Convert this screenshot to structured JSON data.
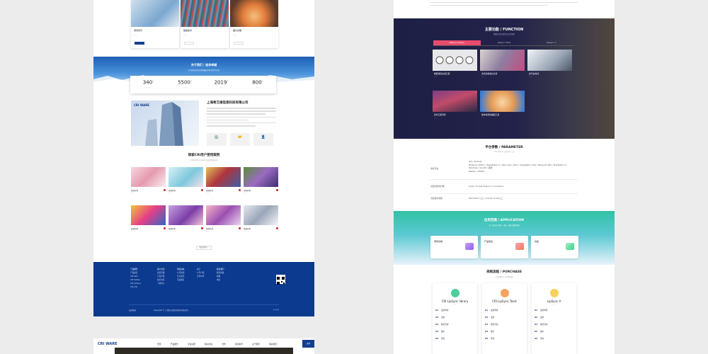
{
  "left": {
    "features": [
      {
        "title": "游戏音乐",
        "desc": "——",
        "button": "——"
      },
      {
        "title": "播放技术",
        "desc": "——",
        "button": "——"
      },
      {
        "title": "图片处理",
        "desc": "——",
        "button": "——"
      }
    ],
    "about": {
      "title": "关于我们 / 追求卓越",
      "subtitle": "以为游戏开发者提供最好的中间件为己任",
      "stats": [
        {
          "num": "340",
          "sup": "+",
          "label": "——"
        },
        {
          "num": "5500",
          "sup": "+",
          "label": "——"
        },
        {
          "num": "2019",
          "sup": "+",
          "label": "——"
        },
        {
          "num": "800",
          "sup": "+",
          "label": "——"
        }
      ]
    },
    "company": {
      "logo": "CRI WARE",
      "name": "上海希艾维信息科技有限公司",
      "icons": [
        "🏢",
        "🤝",
        "👤"
      ]
    },
    "cases": {
      "title": "探索CRI用户使用案例",
      "subtitle": "CRI中间件在全球众多游戏中被采用",
      "items": [
        {
          "title": "游戏名称",
          "sub": "——"
        },
        {
          "title": "游戏名称",
          "sub": "——"
        },
        {
          "title": "游戏名称",
          "sub": "——"
        },
        {
          "title": "游戏名称",
          "sub": "——"
        },
        {
          "title": "游戏名称",
          "sub": "——"
        },
        {
          "title": "游戏名称",
          "sub": "——"
        },
        {
          "title": "游戏名称",
          "sub": "——"
        },
        {
          "title": "游戏名称",
          "sub": "——"
        }
      ],
      "more": "更多案例 >"
    },
    "footer": {
      "cols": [
        {
          "head": "产品服务",
          "items": [
            "产品总览",
            "CRI ADX",
            "CRI Sofdec",
            "CRI LipSync",
            "CRI Clip"
          ]
        },
        {
          "head": "客户支持",
          "items": [
            "常见问题",
            "产品手册",
            "技术支持",
            "下载中心"
          ]
        },
        {
          "head": "新闻动态",
          "items": [
            "公司新闻",
            "行业资讯",
            "活动报名"
          ]
        },
        {
          "head": "关于",
          "items": [
            "公司介绍",
            "合作伙伴"
          ]
        },
        {
          "head": "联系我们",
          "items": [
            "服务热线",
            "邮箱",
            "地址"
          ]
        }
      ],
      "bottom_left": "友情链接",
      "bottom_right": "Copyright © 上海希艾维信息科技有限公司"
    },
    "nav2": {
      "logo": "CRI WARE",
      "items": [
        "首页",
        "产品服务",
        "平台适配",
        "解决方案",
        "合作",
        "新闻资讯",
        "关于我们",
        "联系我们"
      ],
      "cta": "咨询"
    }
  },
  "right": {
    "function": {
      "title": "主要功能 / FUNCTION",
      "subtitle": "根据语音自动生成口型动画",
      "tabs": [
        "LipSync Library",
        "LipSync Tools",
        "LipSync V"
      ],
      "tiles": [
        {
          "title": "根据语音生成口型",
          "desc": "——"
        },
        {
          "title": "支持多种语言分析",
          "desc": "——"
        },
        {
          "title": "多平台支持",
          "desc": "——"
        },
        {
          "title": "实时口型同步",
          "desc": "——"
        },
        {
          "title": "简单易用的编辑工具",
          "desc": "——"
        }
      ]
    },
    "parameter": {
      "title": "平台参数 / PARAMETER",
      "subtitle": "CRI LipSync 支持平台一览",
      "rows": [
        {
          "k": "支持平台",
          "v": "iOS / Android\nNintendo Switch / PlayStation 4 / Xbox One / Wii U / PlayStation Vita / Nintendo 3DS / PlayStation 3\nWindows / macOS / 其他\nWebGL / HTML5"
        },
        {
          "k": "对应的游戏引擎",
          "v": "Unity / Unreal Engine 4 / Cocos2d-x"
        },
        {
          "k": "对应操作系统",
          "v": "Windows7 以上 / macOS 10.12以上"
        }
      ]
    },
    "application": {
      "title": "应用范围 / APPLICATION",
      "subtitle": "可广泛应用于游戏、动画、虚拟主播等领域",
      "cards": [
        {
          "title": "游戏领域",
          "desc": "——"
        },
        {
          "title": "产品用途",
          "desc": "——"
        },
        {
          "title": "动画",
          "desc": "——"
        }
      ]
    },
    "purchase": {
      "title": "采购流程 / PURCHASE",
      "subtitle": "从咨询到导入的简单流程",
      "cards": [
        {
          "name": "CRI LipSync library",
          "sub": "——",
          "steps": [
            "试用申请",
            "试用",
            "购买咨询",
            "报价",
            "签约"
          ]
        },
        {
          "name": "CRI LipSync Tools",
          "sub": "——",
          "steps": [
            "试用申请",
            "试用",
            "购买咨询",
            "报价",
            "签约"
          ]
        },
        {
          "name": "LipSync V",
          "sub": "——",
          "steps": [
            "试用申请",
            "试用",
            "购买咨询",
            "报价",
            "签约"
          ]
        }
      ]
    }
  }
}
